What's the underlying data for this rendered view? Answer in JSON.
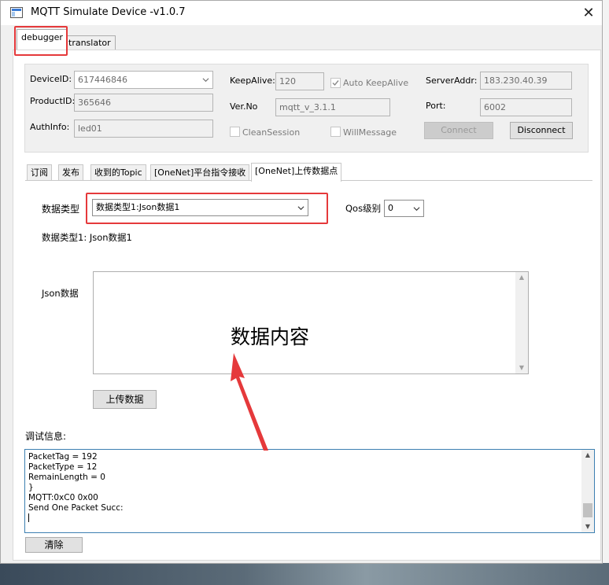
{
  "window": {
    "title": "MQTT Simulate Device  -v1.0.7",
    "close_glyph": "✕"
  },
  "outer_tabs": [
    "debugger",
    "translator"
  ],
  "connection": {
    "device_id_label": "DeviceID:",
    "device_id_value": "617446846",
    "product_id_label": "ProductID:",
    "product_id_value": "365646",
    "auth_info_label": "AuthInfo:",
    "auth_info_value": "led01",
    "keepalive_label": "KeepAlive:",
    "keepalive_value": "120",
    "auto_keepalive_label": "Auto KeepAlive",
    "auto_keepalive_checked": true,
    "ver_label": "Ver.No",
    "ver_value": "mqtt_v_3.1.1",
    "clean_session_label": "CleanSession",
    "will_message_label": "WillMessage",
    "server_addr_label": "ServerAddr:",
    "server_addr_value": "183.230.40.39",
    "port_label": "Port:",
    "port_value": "6002",
    "connect_label": "Connect",
    "disconnect_label": "Disconnect"
  },
  "inner_tabs": [
    "订阅",
    "发布",
    "收到的Topic",
    "[OneNet]平台指令接收",
    "[OneNet]上传数据点"
  ],
  "upload": {
    "data_type_label": "数据类型",
    "data_type_selected": "数据类型1:Json数据1",
    "qos_label": "Qos级别",
    "qos_selected": "0",
    "data_type_desc": "数据类型1: Json数据1",
    "json_label": "Json数据",
    "content_annotation": "数据内容",
    "upload_button": "上传数据"
  },
  "debug": {
    "label": "调试信息:",
    "lines": [
      "PacketTag = 192",
      "PacketType  = 12",
      "RemainLength  = 0",
      "}",
      "MQTT:0xC0 0x00",
      "Send One Packet Succ:"
    ],
    "clear_button": "清除"
  },
  "colors": {
    "highlight": "#e5393b",
    "accent_border": "#3c7fb1"
  },
  "icons": [
    "app-icon",
    "close-icon",
    "chevron-down-icon",
    "checkmark-icon",
    "scroll-up-icon",
    "scroll-down-icon",
    "arrow-annotation"
  ]
}
